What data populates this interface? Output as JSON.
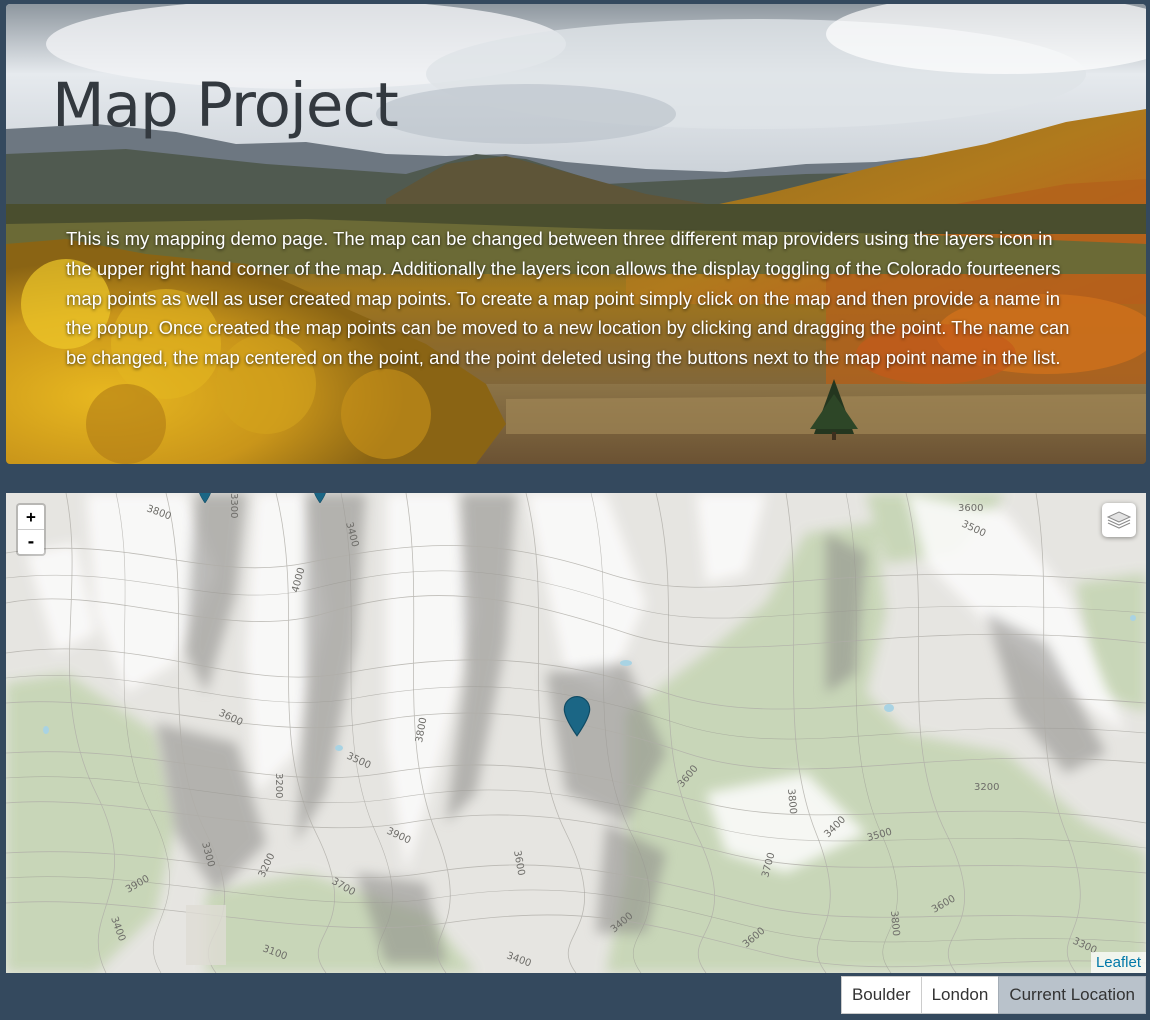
{
  "header": {
    "title": "Map Project",
    "description": "This is my mapping demo page. The map can be changed between three different map providers using the layers icon in the upper right hand corner of the map. Additionally the layers icon allows the display toggling of the Colorado fourteeners map points as well as user created map points. To create a map point simply click on the map and then provide a name in the popup. Once created the map points can be moved to a new location by clicking and dragging the point. The name can be changed, the map centered on the point, and the point deleted using the buttons next to the map point name in the list."
  },
  "map": {
    "zoom_in_label": "+",
    "zoom_out_label": "-",
    "layers_icon": "layers-icon",
    "attribution": "Leaflet",
    "marker_color": "#1b6685",
    "contour_labels": [
      "3800",
      "3400",
      "4000",
      "3600",
      "3500",
      "3600",
      "3800",
      "3500",
      "3900",
      "3300",
      "3200",
      "3600",
      "3700",
      "3900",
      "3400",
      "3200",
      "3100",
      "3400",
      "3400",
      "3600",
      "3600",
      "3800",
      "3700",
      "3400",
      "3500",
      "3200",
      "3800",
      "3600",
      "3300",
      "3300"
    ]
  },
  "location_buttons": [
    {
      "label": "Boulder",
      "active": false
    },
    {
      "label": "London",
      "active": false
    },
    {
      "label": "Current Location",
      "active": true
    }
  ],
  "colors": {
    "page_background": "#34495e",
    "title_color": "#33393f",
    "link_color": "#0078a8"
  }
}
